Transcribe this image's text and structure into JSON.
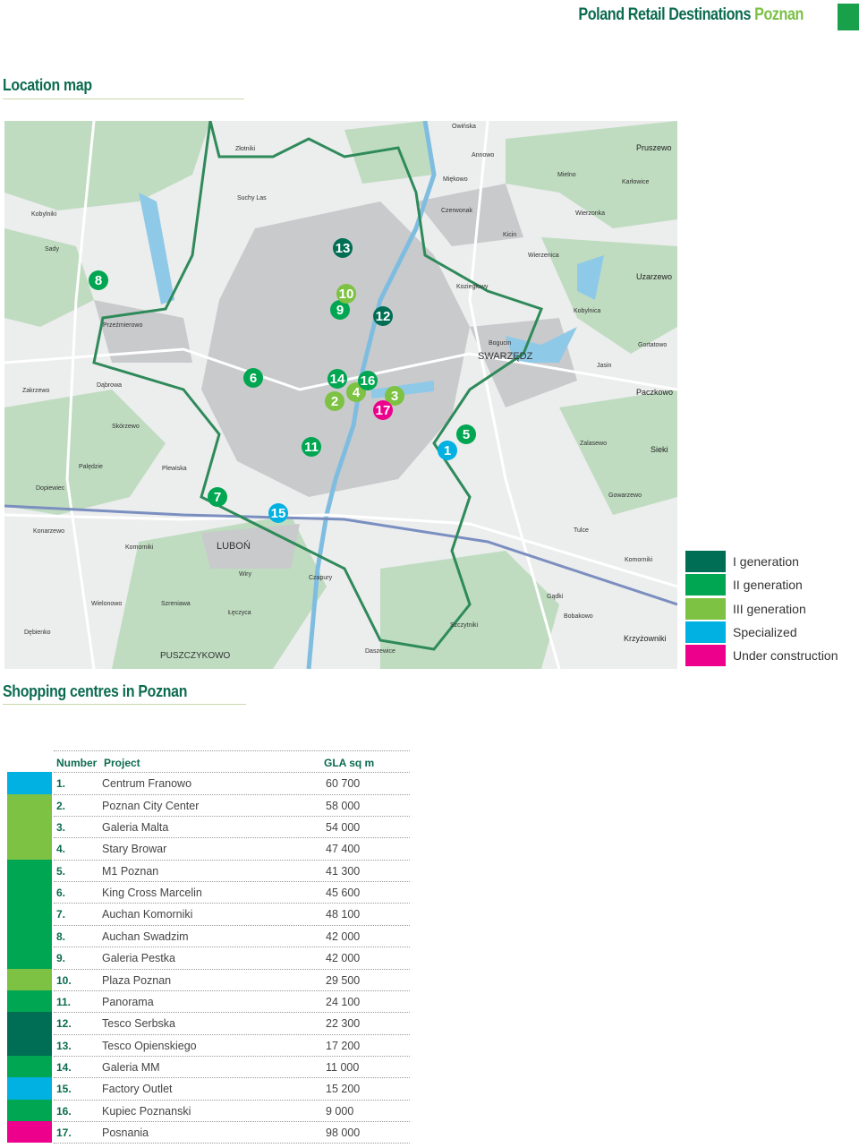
{
  "header": {
    "title_main": "Poland Retail Destinations",
    "title_city": "Poznan",
    "accent": "#7ac143",
    "brand": "#0b6b4f"
  },
  "sections": {
    "map_title": "Location map",
    "table_title": "Shopping centres in Poznan"
  },
  "legend": [
    {
      "label": "I generation",
      "color": "#006e54"
    },
    {
      "label": "II generation",
      "color": "#00a651"
    },
    {
      "label": "III generation",
      "color": "#7dc242"
    },
    {
      "label": "Specialized",
      "color": "#00b1e1"
    },
    {
      "label": "Under construction",
      "color": "#ec008c"
    }
  ],
  "map": {
    "places": [
      "Złotniki",
      "Suchy Las",
      "Kobylniki",
      "Sady",
      "Przeźmierowo",
      "Dąbrowa",
      "Zakrzewo",
      "Skórzewo",
      "Palędzie",
      "Plewiska",
      "Dopiewiec",
      "Konarzewo",
      "Komorniki",
      "LUBOŃ",
      "Wiry",
      "Łęczyca",
      "Wielonowo",
      "Szreniawa",
      "PUSZCZYKOWO",
      "Dębienko",
      "Czapury",
      "Daszewice",
      "Szczytniki",
      "Gądki",
      "Bobakowo",
      "Tulce",
      "Gowarzewo",
      "Komorniki",
      "Krzyżowniki",
      "Zalasewo",
      "SWARZĘDZ",
      "Bogucin",
      "Jasin",
      "Kobylnica",
      "Wierzonka",
      "Wierzenica",
      "Kicin",
      "Czerwonak",
      "Koziegłowy",
      "Annowo",
      "Miękowo",
      "Owińska",
      "Mielno",
      "Karłowice",
      "Uzarzewo",
      "Gortatowo",
      "Paczkowo",
      "Sieki",
      "Pruszewo"
    ],
    "markers": [
      {
        "n": "1",
        "gen": "Specialized"
      },
      {
        "n": "2",
        "gen": "III generation"
      },
      {
        "n": "3",
        "gen": "III generation"
      },
      {
        "n": "4",
        "gen": "III generation"
      },
      {
        "n": "5",
        "gen": "II generation"
      },
      {
        "n": "6",
        "gen": "II generation"
      },
      {
        "n": "7",
        "gen": "II generation"
      },
      {
        "n": "8",
        "gen": "II generation"
      },
      {
        "n": "9",
        "gen": "II generation"
      },
      {
        "n": "10",
        "gen": "III generation"
      },
      {
        "n": "11",
        "gen": "II generation"
      },
      {
        "n": "12",
        "gen": "I generation"
      },
      {
        "n": "13",
        "gen": "I generation"
      },
      {
        "n": "14",
        "gen": "II generation"
      },
      {
        "n": "15",
        "gen": "Specialized"
      },
      {
        "n": "16",
        "gen": "II generation"
      },
      {
        "n": "17",
        "gen": "Under construction"
      }
    ]
  },
  "table": {
    "headers": {
      "number": "Number",
      "project": "Project",
      "gla": "GLA sq m"
    },
    "rows": [
      {
        "number": "1.",
        "project": "Centrum Franowo",
        "gla": "60 700",
        "color": "#00b1e1"
      },
      {
        "number": "2.",
        "project": "Poznan City Center",
        "gla": "58 000",
        "color": "#7dc242"
      },
      {
        "number": "3.",
        "project": "Galeria Malta",
        "gla": "54 000",
        "color": "#7dc242"
      },
      {
        "number": "4.",
        "project": "Stary Browar",
        "gla": "47 400",
        "color": "#7dc242"
      },
      {
        "number": "5.",
        "project": "M1 Poznan",
        "gla": "41 300",
        "color": "#00a651"
      },
      {
        "number": "6.",
        "project": "King Cross Marcelin",
        "gla": "45 600",
        "color": "#00a651"
      },
      {
        "number": "7.",
        "project": "Auchan  Komorniki",
        "gla": "48 100",
        "color": "#00a651"
      },
      {
        "number": "8.",
        "project": "Auchan Swadzim",
        "gla": "42 000",
        "color": "#00a651"
      },
      {
        "number": "9.",
        "project": "Galeria Pestka",
        "gla": "42 000",
        "color": "#00a651"
      },
      {
        "number": "10.",
        "project": "Plaza Poznan",
        "gla": "29 500",
        "color": "#7dc242"
      },
      {
        "number": "11.",
        "project": "Panorama",
        "gla": "24 100",
        "color": "#00a651"
      },
      {
        "number": "12.",
        "project": "Tesco Serbska",
        "gla": "22 300",
        "color": "#006e54"
      },
      {
        "number": "13.",
        "project": "Tesco Opienskiego",
        "gla": "17 200",
        "color": "#006e54"
      },
      {
        "number": "14.",
        "project": "Galeria MM",
        "gla": "11 000",
        "color": "#00a651"
      },
      {
        "number": "15.",
        "project": "Factory Outlet",
        "gla": "15 200",
        "color": "#00b1e1"
      },
      {
        "number": "16.",
        "project": "Kupiec Poznanski",
        "gla": "9 000",
        "color": "#00a651"
      },
      {
        "number": "17.",
        "project": "Posnania",
        "gla": "98 000",
        "color": "#ec008c"
      }
    ]
  }
}
